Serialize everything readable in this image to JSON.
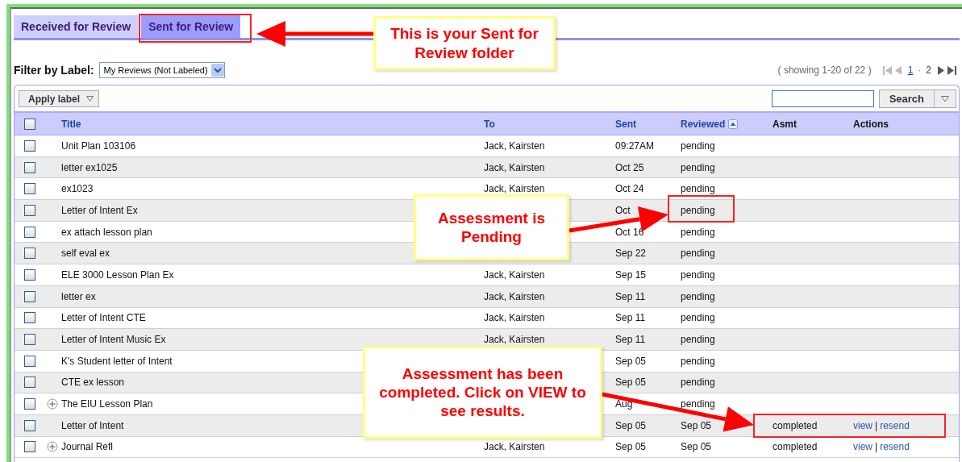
{
  "tabs": [
    {
      "label": "Received for Review",
      "selected": false
    },
    {
      "label": "Sent for Review",
      "selected": true
    }
  ],
  "filter": {
    "label": "Filter by Label:",
    "value": "My Reviews (Not Labeled)"
  },
  "pagination": {
    "summary": "( showing 1-20 of 22 )",
    "separator": "·",
    "pages": [
      {
        "label": "1",
        "selected": true
      },
      {
        "label": "2",
        "selected": false
      }
    ]
  },
  "toolbar": {
    "apply_label": "Apply label",
    "search_button": "Search"
  },
  "table": {
    "columns": [
      {
        "label": "Title",
        "sortable": true,
        "sorted": false
      },
      {
        "label": "To",
        "sortable": true,
        "sorted": false
      },
      {
        "label": "Sent",
        "sortable": true,
        "sorted": false
      },
      {
        "label": "Reviewed",
        "sortable": true,
        "sorted": true
      },
      {
        "label": "Asmt",
        "sortable": false,
        "sorted": false
      },
      {
        "label": "Actions",
        "sortable": false,
        "sorted": false
      }
    ],
    "all_checked": false,
    "action_separator": "|",
    "rows": [
      {
        "title": "Unit Plan 103106",
        "to": "Jack, Kairsten",
        "sent": "09:27AM",
        "reviewed": "pending",
        "checked": false,
        "expandable": false
      },
      {
        "title": "letter ex1025",
        "to": "Jack, Kairsten",
        "sent": "Oct 25",
        "reviewed": "pending",
        "checked": false,
        "expandable": false
      },
      {
        "title": "ex1023",
        "to": "Jack, Kairsten",
        "sent": "Oct 24",
        "reviewed": "pending",
        "checked": false,
        "expandable": false
      },
      {
        "title": "Letter of Intent Ex",
        "sent": "Oct",
        "reviewed": "pending",
        "checked": false,
        "expandable": false
      },
      {
        "title": "ex attach lesson plan",
        "sent": "Oct 16",
        "reviewed": "pending",
        "checked": false,
        "expandable": false
      },
      {
        "title": "self eval ex",
        "sent": "Sep 22",
        "reviewed": "pending",
        "checked": false,
        "expandable": false
      },
      {
        "title": "ELE 3000 Lesson Plan Ex",
        "to": "Jack, Kairsten",
        "sent": "Sep 15",
        "reviewed": "pending",
        "checked": false,
        "expandable": false
      },
      {
        "title": "letter ex",
        "to": "Jack, Kairsten",
        "sent": "Sep 11",
        "reviewed": "pending",
        "checked": false,
        "expandable": false
      },
      {
        "title": "Letter of Intent CTE",
        "to": "Jack, Kairsten",
        "sent": "Sep 11",
        "reviewed": "pending",
        "checked": false,
        "expandable": false
      },
      {
        "title": "Letter of Intent Music Ex",
        "to": "Jack, Kairsten",
        "sent": "Sep 11",
        "reviewed": "pending",
        "checked": false,
        "expandable": false
      },
      {
        "title": "K's Student letter of Intent",
        "sent": "Sep 05",
        "reviewed": "pending",
        "checked": false,
        "expandable": false
      },
      {
        "title": "CTE ex lesson",
        "sent": "Sep 05",
        "reviewed": "pending",
        "checked": false,
        "expandable": false
      },
      {
        "title": "The EIU Lesson Plan",
        "sent": "Aug",
        "reviewed": "pending",
        "checked": false,
        "expandable": true
      },
      {
        "title": "Letter of Intent",
        "sent": "Sep 05",
        "reviewed": "Sep 05",
        "asmt": "completed",
        "actions": [
          "view",
          "resend"
        ],
        "checked": false,
        "expandable": false
      },
      {
        "title": "Journal Refl",
        "to": "Jack, Kairsten",
        "sent": "Sep 05",
        "reviewed": "Sep 05",
        "asmt": "completed",
        "actions": [
          "view",
          "resend"
        ],
        "checked": false,
        "expandable": true
      }
    ]
  },
  "callouts": [
    {
      "text": "This is your Sent for Review folder"
    },
    {
      "text": "Assessment is Pending"
    },
    {
      "text": "Assessment has been completed. Click on VIEW to see results."
    }
  ]
}
